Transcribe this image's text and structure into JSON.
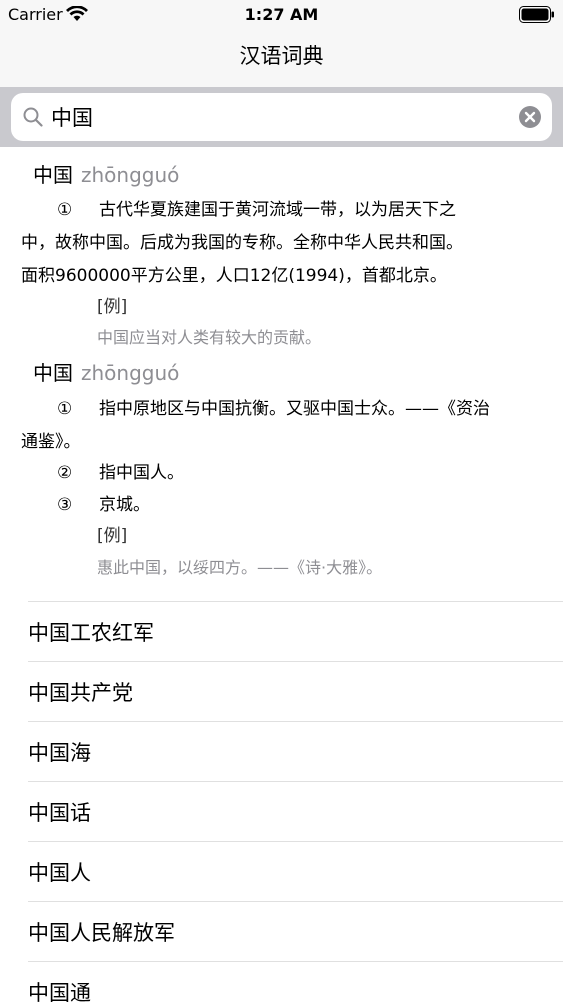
{
  "status_bar": {
    "carrier": "Carrier",
    "time": "1:27 AM"
  },
  "nav": {
    "title": "汉语词典"
  },
  "search": {
    "value": "中国"
  },
  "entries": [
    {
      "word": "中国",
      "pinyin": "zhōngguó",
      "senses": [
        {
          "num": "①",
          "lines": [
            "古代华夏族建国于黄河流域一带，以为居天下之",
            "中，故称中国。后成为我国的专称。全称中华人民共和国。",
            "面积9600000平方公里，人口12亿(1994)，首都北京。"
          ]
        }
      ],
      "example_label": "[例]",
      "example": "中国应当对人类有较大的贡献。"
    },
    {
      "word": "中国",
      "pinyin": "zhōngguó",
      "senses": [
        {
          "num": "①",
          "lines": [
            "指中原地区与中国抗衡。又驱中国士众。——《资治",
            "通鉴》。"
          ]
        },
        {
          "num": "②",
          "lines": [
            "指中国人。"
          ]
        },
        {
          "num": "③",
          "lines": [
            "京城。"
          ]
        }
      ],
      "example_label": "[例]",
      "example": "惠此中国，以绥四方。——《诗·大雅》。"
    }
  ],
  "related": [
    "中国工农红军",
    "中国共产党",
    "中国海",
    "中国话",
    "中国人",
    "中国人民解放军",
    "中国通"
  ]
}
